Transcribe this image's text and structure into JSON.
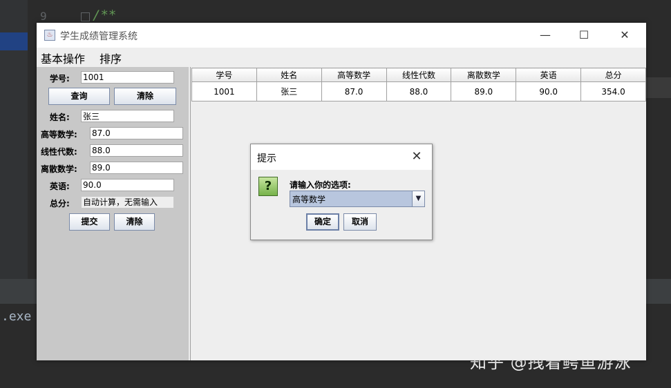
{
  "ide": {
    "line_number": "9",
    "code_snippet": "/**",
    "console_text": ".exe"
  },
  "watermark": "知乎 @拽着鳄鱼游泳",
  "window": {
    "title": "学生成绩管理系统",
    "controls": {
      "minimize": "—",
      "maximize": "☐",
      "close": "✕"
    }
  },
  "menu": {
    "items": [
      "基本操作",
      "排序"
    ]
  },
  "form": {
    "id_label": "学号:",
    "id_value": "1001",
    "query_button": "查询",
    "clear_button_top": "清除",
    "name_label": "姓名:",
    "name_value": "张三",
    "math_label": "高等数学:",
    "math_value": "87.0",
    "linear_label": "线性代数:",
    "linear_value": "88.0",
    "discrete_label": "离散数学:",
    "discrete_value": "89.0",
    "english_label": "英语:",
    "english_value": "90.0",
    "total_label": "总分:",
    "total_placeholder": "自动计算，无需输入",
    "submit_button": "提交",
    "clear_button_bottom": "清除"
  },
  "table": {
    "columns": [
      "学号",
      "姓名",
      "高等数学",
      "线性代数",
      "离散数学",
      "英语",
      "总分"
    ],
    "rows": [
      [
        "1001",
        "张三",
        "87.0",
        "88.0",
        "89.0",
        "90.0",
        "354.0"
      ]
    ]
  },
  "dialog": {
    "title": "提示",
    "close": "✕",
    "icon": "question-icon",
    "icon_glyph": "?",
    "message": "请输入你的选项:",
    "selected_option": "高等数学",
    "ok_button": "确定",
    "cancel_button": "取消"
  }
}
